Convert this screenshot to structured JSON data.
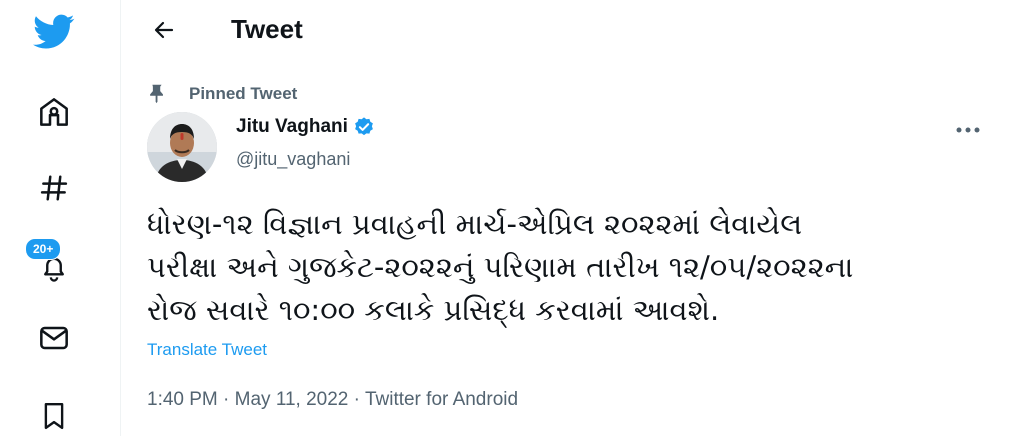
{
  "sidebar": {
    "badge_count": "20+",
    "items": [
      {
        "icon": "twitter-bird-icon"
      },
      {
        "icon": "home-icon"
      },
      {
        "icon": "hashtag-icon"
      },
      {
        "icon": "bell-icon"
      },
      {
        "icon": "mail-icon"
      },
      {
        "icon": "bookmark-icon"
      }
    ]
  },
  "header": {
    "title": "Tweet"
  },
  "tweet": {
    "pinned_label": "Pinned Tweet",
    "author_name": "Jitu Vaghani",
    "author_handle": "@jitu_vaghani",
    "text": "ધોરણ-૧૨ વિજ્ઞાન પ્રવાહની માર્ચ-એપ્રિલ ૨૦૨૨માં લેવાયેલ\nપરીક્ષા અને ગુજકેટ-૨૦૨૨નું પરિણામ તારીખ ૧૨/૦૫/૨૦૨૨ના\nરોજ સવારે ૧૦:૦૦ કલાકે પ્રસિદ્ધ કરવામાં આવશે.",
    "translate_label": "Translate Tweet",
    "time": "1:40 PM",
    "date": "May 11, 2022",
    "source": "Twitter for Android",
    "separator": " · "
  },
  "colors": {
    "accent": "#1d9bf0",
    "text": "#0f1419",
    "muted": "#536471"
  }
}
